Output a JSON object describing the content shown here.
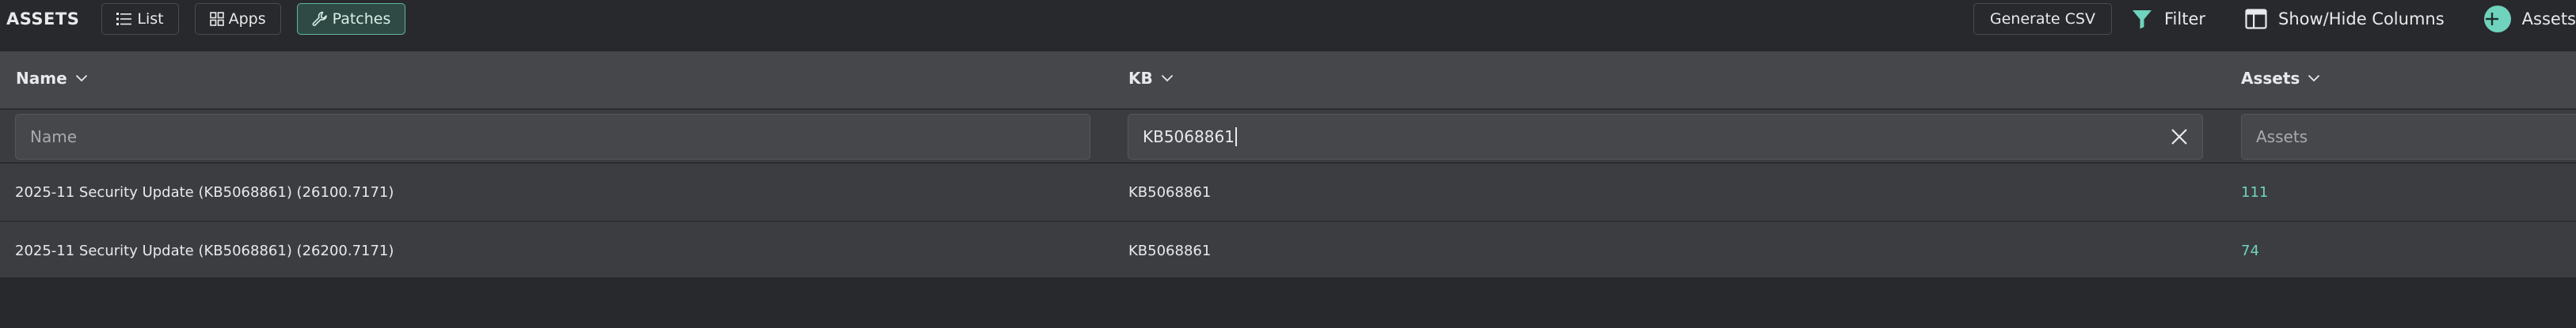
{
  "toolbar": {
    "title": "ASSETS",
    "tabs": [
      {
        "label": "List",
        "icon": "list-icon"
      },
      {
        "label": "Apps",
        "icon": "grid-icon"
      },
      {
        "label": "Patches",
        "icon": "wrench-icon",
        "active": true
      }
    ],
    "generate_csv": "Generate CSV",
    "filter": "Filter",
    "show_hide_columns": "Show/Hide Columns",
    "assets": "Assets"
  },
  "columns": {
    "name": "Name",
    "kb": "KB",
    "assets": "Assets"
  },
  "filters": {
    "name_placeholder": "Name",
    "kb_value": "KB5068861",
    "assets_placeholder": "Assets"
  },
  "rows": [
    {
      "name": "2025-11 Security Update (KB5068861) (26100.7171)",
      "kb": "KB5068861",
      "assets": "111"
    },
    {
      "name": "2025-11 Security Update (KB5068861) (26200.7171)",
      "kb": "KB5068861",
      "assets": "74"
    }
  ],
  "colors": {
    "accent": "#6fd3bd",
    "background": "#28292c",
    "header": "#45474b",
    "row": "#3b3d41"
  }
}
